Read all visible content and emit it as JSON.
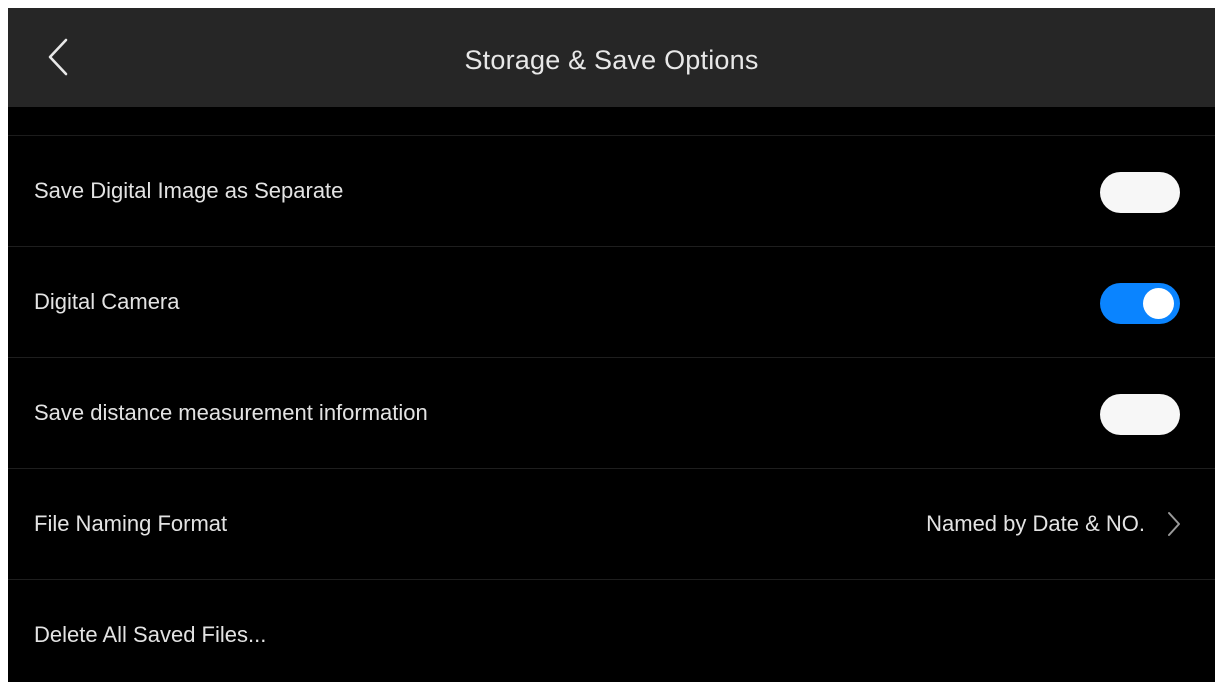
{
  "header": {
    "title": "Storage & Save Options",
    "back_icon": "chevron-left-icon"
  },
  "settings": {
    "save_digital_image": {
      "label": "Save Digital Image as Separate",
      "enabled": false
    },
    "digital_camera": {
      "label": "Digital Camera",
      "enabled": true
    },
    "save_distance": {
      "label": "Save distance measurement information",
      "enabled": false
    },
    "file_naming": {
      "label": "File Naming Format",
      "value": "Named by Date & NO.",
      "icon": "chevron-right-icon"
    },
    "delete_all": {
      "label": "Delete All Saved Files..."
    }
  },
  "colors": {
    "toggle_on": "#0a84ff",
    "toggle_off": "#f7f7f7",
    "header_bg": "#262626",
    "background": "#000000"
  }
}
